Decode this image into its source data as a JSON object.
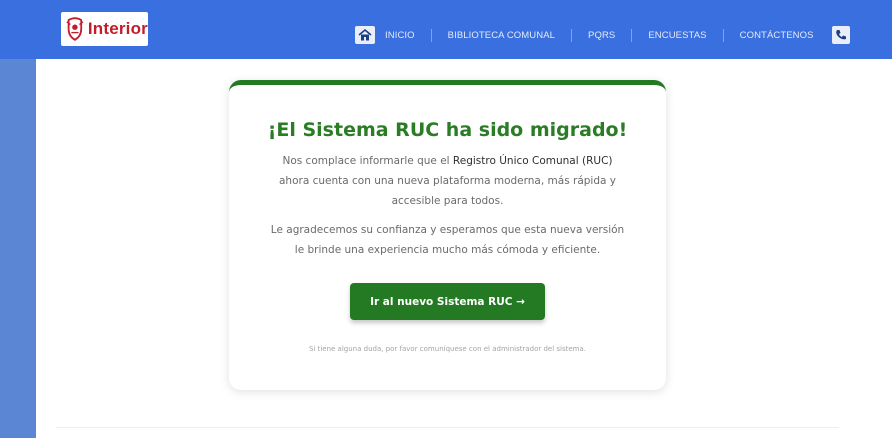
{
  "brand": {
    "logo_text": "Interior"
  },
  "nav": {
    "items": [
      "INICIO",
      "BIBLIOTECA COMUNAL",
      "PQRS",
      "ENCUESTAS",
      "CONTÁCTENOS"
    ]
  },
  "card": {
    "title": "¡El Sistema RUC ha sido migrado!",
    "p1_before": "Nos complace informarle que el ",
    "p1_strong": "Registro Único Comunal (RUC)",
    "p1_after": " ahora cuenta con una nueva plataforma moderna, más rápida y accesible para todos.",
    "p2": "Le agradecemos su confianza y esperamos que esta nueva versión le brinde una experiencia mucho más cómoda y eficiente.",
    "button_label": "Ir al nuevo Sistema RUC →",
    "footnote": "Si tiene alguna duda, por favor comuníquese con el administrador del sistema."
  },
  "colors": {
    "topbar": "#3a6fe0",
    "accent_green": "#247a22",
    "logo_red": "#c21d2c"
  },
  "icons": [
    "crest-icon",
    "home-icon",
    "phone-icon"
  ]
}
